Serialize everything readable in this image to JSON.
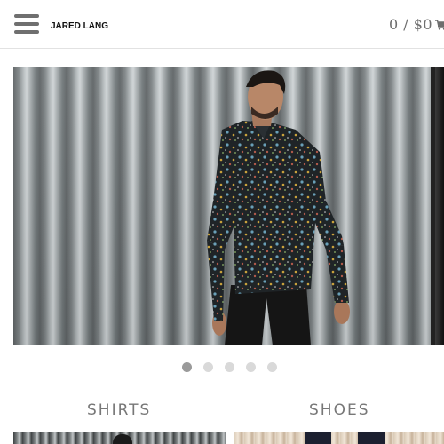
{
  "header": {
    "brand": "JARED LANG",
    "cart_text": "0 / $0"
  },
  "hero": {
    "slide_count": 5,
    "active_slide": 1
  },
  "categories": [
    {
      "label": "SHIRTS"
    },
    {
      "label": "SHOES"
    }
  ],
  "colors": {
    "text_gray": "#777777",
    "divider": "#e2e2e2",
    "dot_inactive": "#d9d9d9",
    "dot_active": "#9a9a9a"
  },
  "icons": {
    "menu": "hamburger-icon",
    "cart": "cart-icon"
  }
}
